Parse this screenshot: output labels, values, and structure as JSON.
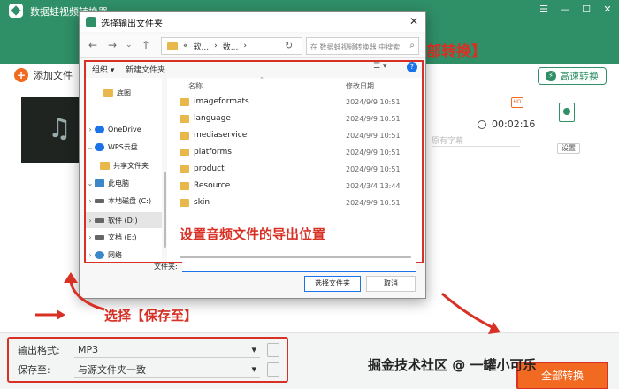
{
  "app": {
    "title": "数据蛙视频转换器",
    "window_controls": [
      "☰",
      "—",
      "☐",
      "✕"
    ]
  },
  "toolbar": {
    "add_file": "添加文件",
    "fast_convert": "高速转换"
  },
  "file_item": {
    "duration": "00:02:16",
    "subtitle_placeholder": "原有字幕",
    "settings_label": "设置",
    "tag": "HD"
  },
  "dialog": {
    "title": "选择输出文件夹",
    "path": [
      "软...",
      "数..."
    ],
    "search_placeholder": "在 数据蛙视频转换器 中搜索",
    "organize": "组织 ▾",
    "new_folder": "新建文件夹",
    "nav_items": [
      {
        "label": "底图",
        "icon": "folder",
        "chev": ""
      },
      {
        "label": "OneDrive",
        "icon": "cloud",
        "chev": "›"
      },
      {
        "label": "WPS云盘",
        "icon": "cloud",
        "chev": "⌄"
      },
      {
        "label": "共享文件夹",
        "icon": "folder",
        "chev": ""
      },
      {
        "label": "此电脑",
        "icon": "pc",
        "chev": "⌄"
      },
      {
        "label": "本地磁盘 (C:)",
        "icon": "drive",
        "chev": "›"
      },
      {
        "label": "软件 (D:)",
        "icon": "drive",
        "chev": "›"
      },
      {
        "label": "文档 (E:)",
        "icon": "drive",
        "chev": "›"
      },
      {
        "label": "网络",
        "icon": "net",
        "chev": "›"
      }
    ],
    "columns": {
      "name": "名称",
      "date": "修改日期"
    },
    "files": [
      {
        "name": "imageformats",
        "date": "2024/9/9 10:51"
      },
      {
        "name": "language",
        "date": "2024/9/9 10:51"
      },
      {
        "name": "mediaservice",
        "date": "2024/9/9 10:51"
      },
      {
        "name": "platforms",
        "date": "2024/9/9 10:51"
      },
      {
        "name": "product",
        "date": "2024/9/9 10:51"
      },
      {
        "name": "Resource",
        "date": "2024/3/4 13:44"
      },
      {
        "name": "skin",
        "date": "2024/9/9 10:51"
      }
    ],
    "overlay_tip": "设置音频文件的导出位置",
    "filename_label": "文件夹:",
    "filename_value": "",
    "select_button": "选择文件夹",
    "cancel_button": "取消"
  },
  "bottom": {
    "format_label": "输出格式:",
    "format_value": "MP3",
    "save_label": "保存至:",
    "save_value": "与源文件夹一致",
    "convert_all": "全部转换",
    "tip_convert": "点击【全部转换】",
    "tip_choose": "选择【保存至】"
  },
  "watermark": "掘金技术社区 @ 一罐小可乐",
  "colors": {
    "brand": "#2f8f67",
    "accent": "#f26a21",
    "annotation": "#d93025"
  }
}
